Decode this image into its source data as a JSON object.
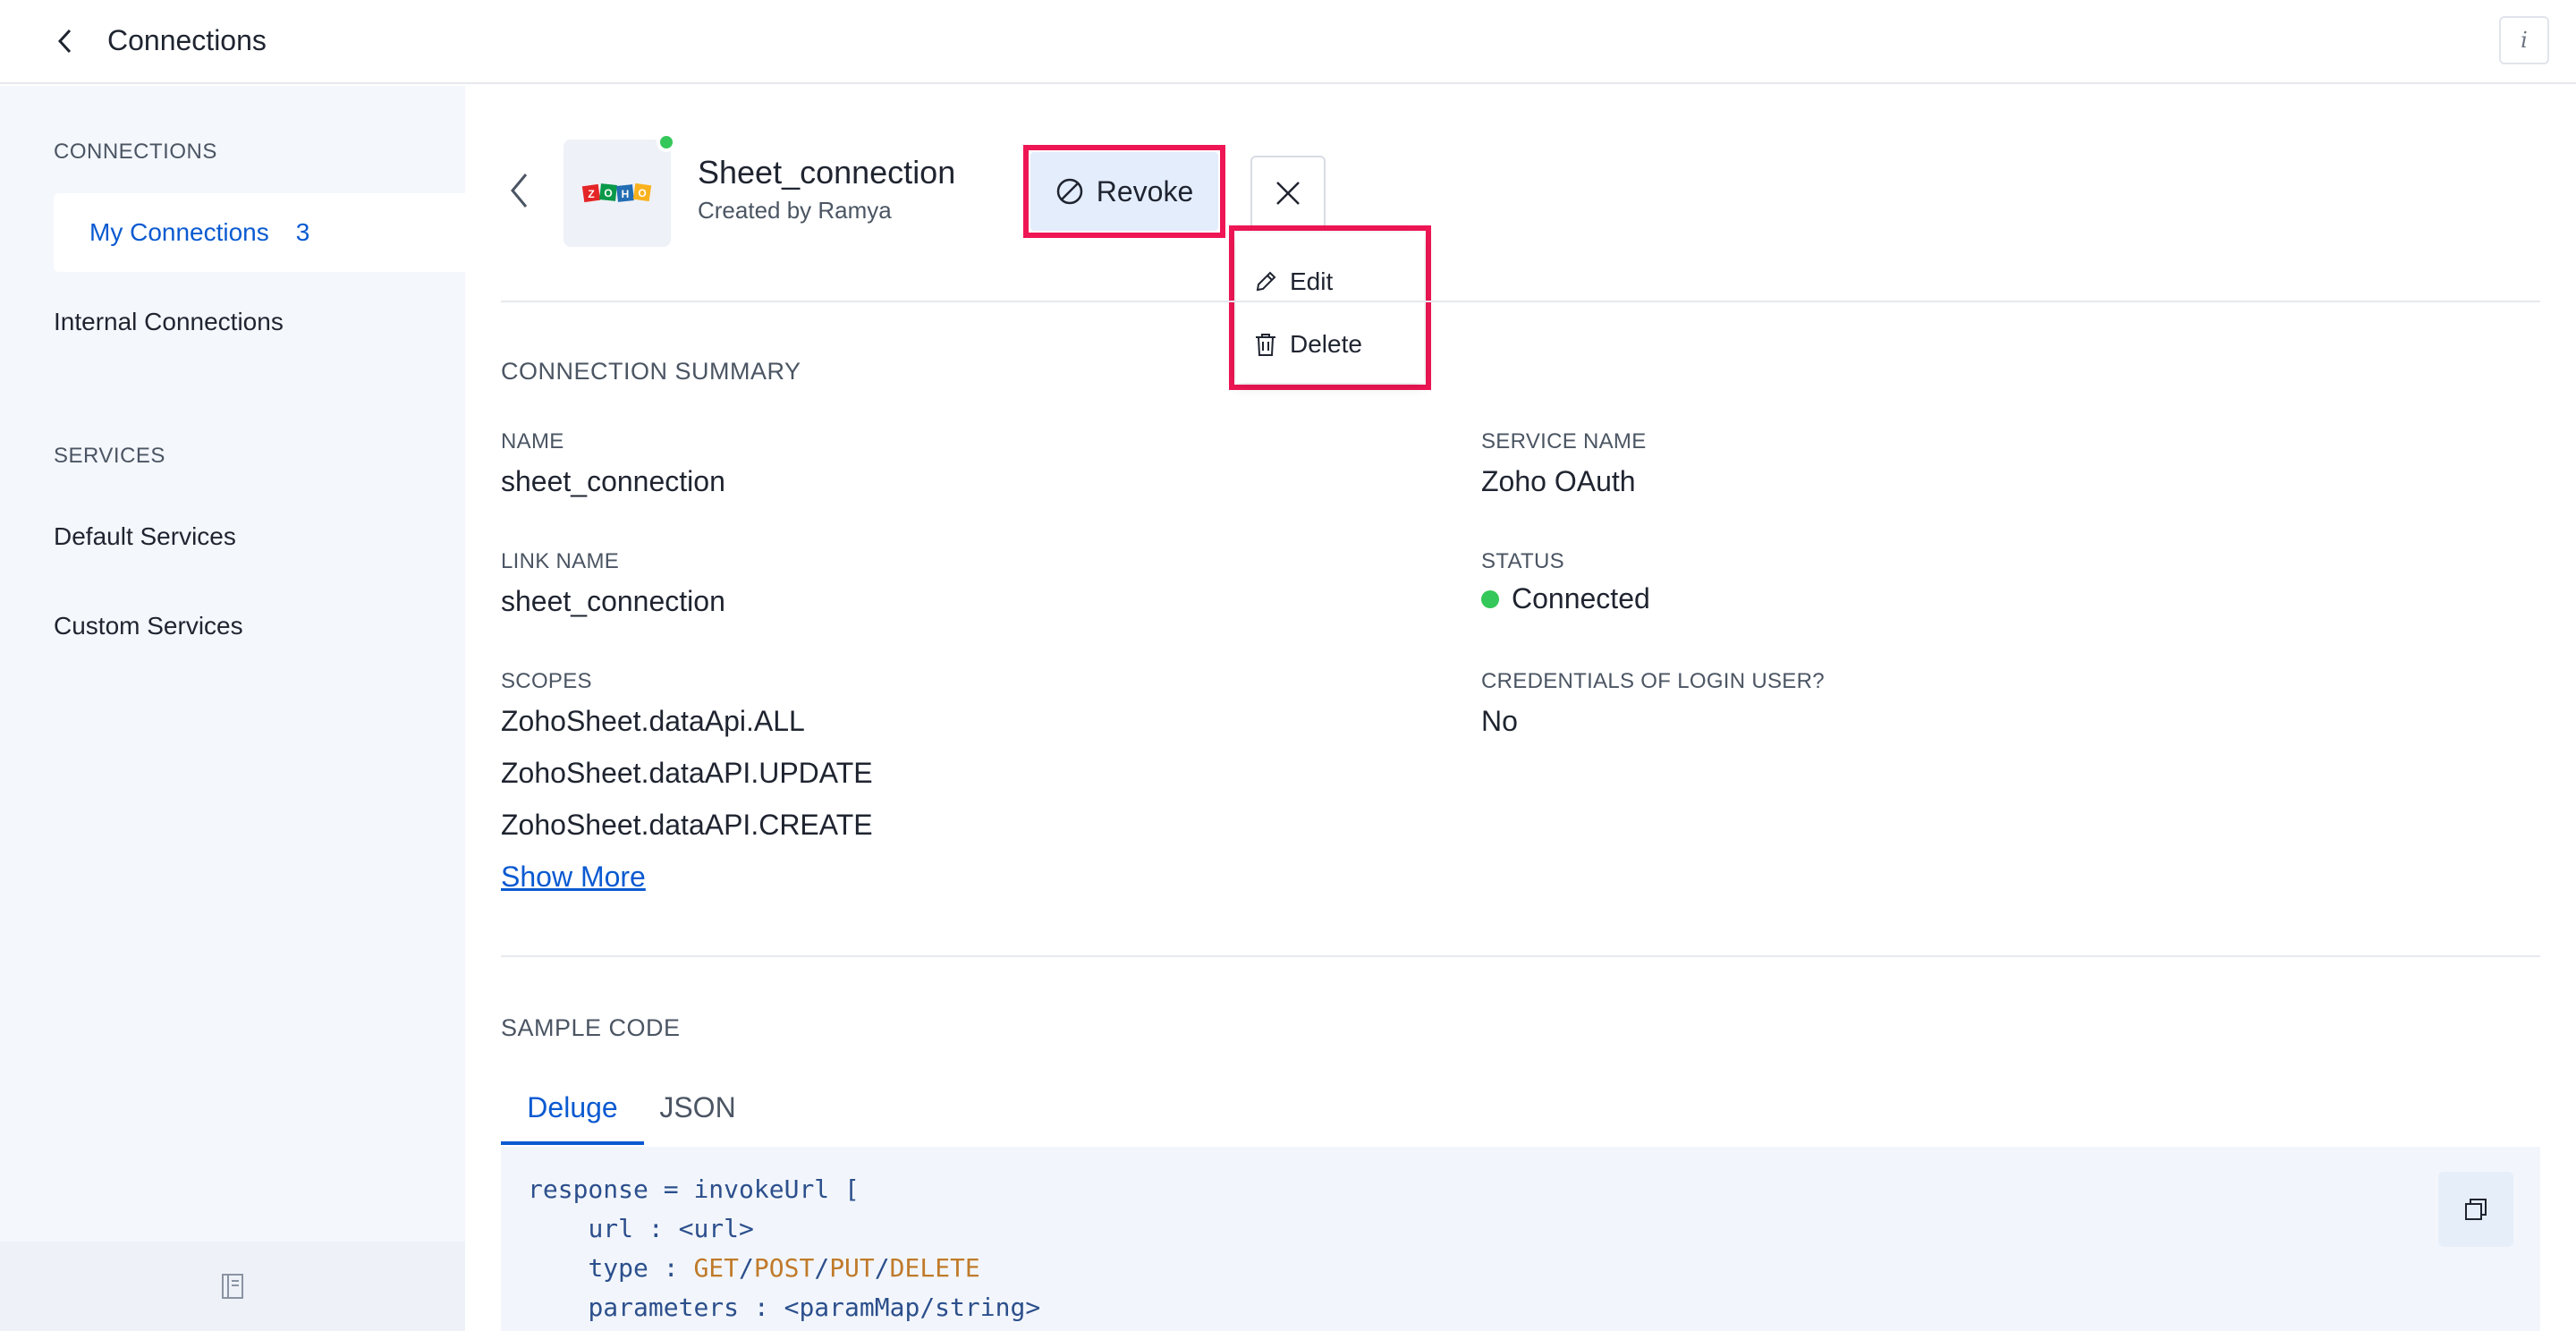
{
  "topbar": {
    "title": "Connections",
    "info_glyph": "i"
  },
  "sidebar": {
    "connections_heading": "CONNECTIONS",
    "my_connections": {
      "label": "My Connections",
      "count": "3"
    },
    "internal_connections": "Internal Connections",
    "services_heading": "SERVICES",
    "default_services": "Default Services",
    "custom_services": "Custom Services"
  },
  "connection": {
    "name": "Sheet_connection",
    "created_by": "Created by Ramya",
    "logo_text": "ZOHO",
    "revoke_label": "Revoke",
    "menu": {
      "edit": "Edit",
      "delete": "Delete"
    }
  },
  "summary": {
    "title": "CONNECTION SUMMARY",
    "name_label": "NAME",
    "name_value": "sheet_connection",
    "service_label": "SERVICE NAME",
    "service_value": "Zoho OAuth",
    "link_label": "LINK NAME",
    "link_value": "sheet_connection",
    "status_label": "STATUS",
    "status_value": "Connected",
    "scopes_label": "SCOPES",
    "scopes": [
      "ZohoSheet.dataApi.ALL",
      "ZohoSheet.dataAPI.UPDATE",
      "ZohoSheet.dataAPI.CREATE"
    ],
    "show_more": "Show More",
    "credentials_label": "CREDENTIALS OF LOGIN USER?",
    "credentials_value": "No"
  },
  "sample_code": {
    "title": "SAMPLE CODE",
    "tabs": [
      "Deluge",
      "JSON"
    ],
    "code": {
      "l1_var": "response",
      "l1_op": " = ",
      "l1_fn": "invokeUrl",
      "l1_end": " [",
      "l2_key": "url",
      "l2_sep": " : ",
      "l2_val": "<url>",
      "l3_key": "type",
      "l3_sep": " : ",
      "l3_get": "GET",
      "l3_post": "POST",
      "l3_put": "PUT",
      "l3_delete": "DELETE",
      "slash": "/",
      "l4_key": "parameters",
      "l4_sep": " : ",
      "l4_a": "<paramMap",
      "l4_b": "string",
      "l4_c": ">"
    }
  },
  "colors": {
    "accent": "#0a5ad1",
    "highlight": "#ee1654",
    "status_green": "#34c759"
  },
  "icons": [
    "chevron-left-icon",
    "info-icon",
    "revoke-icon",
    "close-icon",
    "edit-icon",
    "trash-icon",
    "copy-icon",
    "book-icon"
  ]
}
